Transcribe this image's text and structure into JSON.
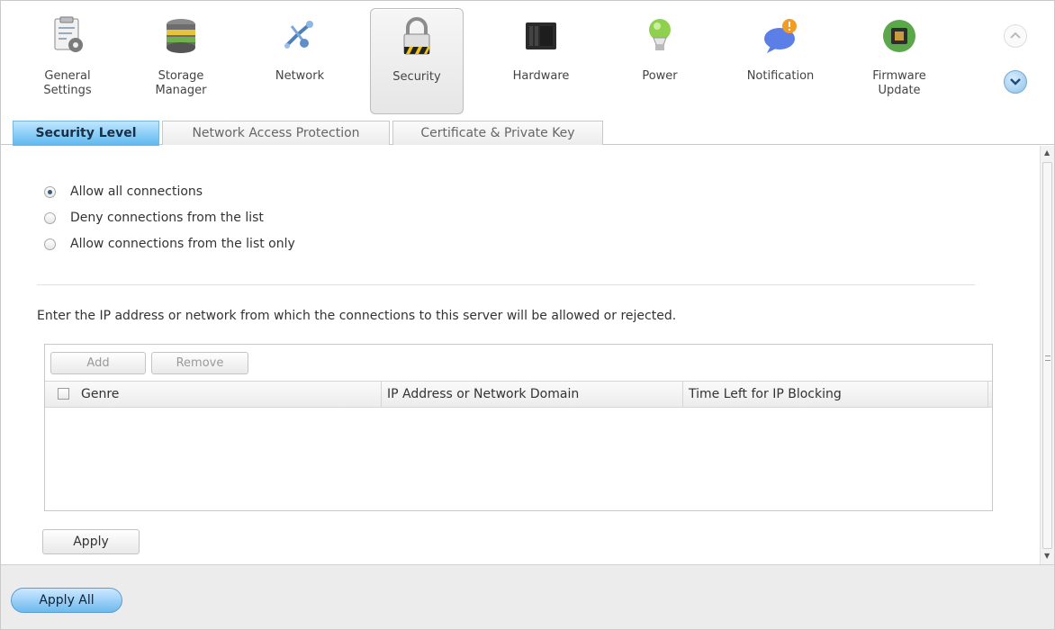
{
  "toolbar": {
    "items": [
      {
        "label": "General\nSettings",
        "icon": "general-settings-icon"
      },
      {
        "label": "Storage\nManager",
        "icon": "storage-manager-icon"
      },
      {
        "label": "Network",
        "icon": "network-icon"
      },
      {
        "label": "Security",
        "icon": "security-lock-icon",
        "active": true
      },
      {
        "label": "Hardware",
        "icon": "hardware-icon"
      },
      {
        "label": "Power",
        "icon": "power-bulb-icon"
      },
      {
        "label": "Notification",
        "icon": "notification-icon"
      },
      {
        "label": "Firmware\nUpdate",
        "icon": "firmware-update-icon"
      }
    ]
  },
  "tabs": [
    {
      "label": "Security Level",
      "active": true
    },
    {
      "label": "Network Access Protection"
    },
    {
      "label": "Certificate & Private Key"
    }
  ],
  "security": {
    "options": [
      {
        "label": "Allow all connections",
        "checked": true
      },
      {
        "label": "Deny connections from the list",
        "checked": false
      },
      {
        "label": "Allow connections from the list only",
        "checked": false
      }
    ],
    "instruction": "Enter the IP address or network from which the connections to this server will be allowed or rejected.",
    "add_label": "Add",
    "remove_label": "Remove",
    "columns": [
      "Genre",
      "IP Address or Network Domain",
      "Time Left for IP Blocking"
    ],
    "apply_label": "Apply"
  },
  "footer": {
    "apply_all_label": "Apply All"
  },
  "colors": {
    "active_tab": "#5bb7ee",
    "apply_all": "#6db9ef"
  }
}
